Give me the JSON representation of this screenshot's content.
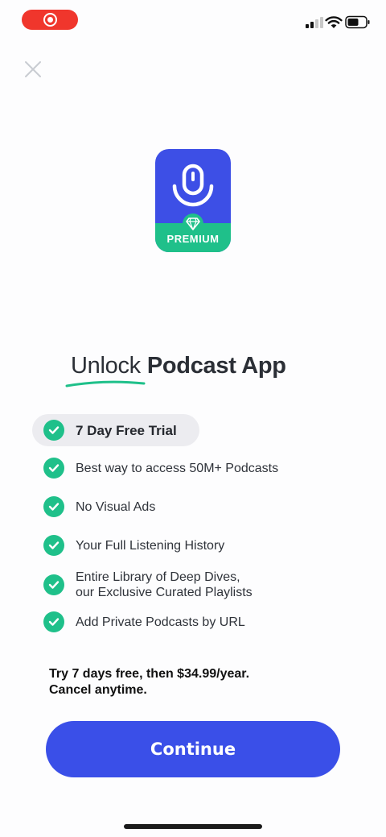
{
  "status_bar": {
    "recording_icon": "record-icon",
    "signal_icon": "cellular-signal-icon",
    "wifi_icon": "wifi-icon",
    "battery_icon": "battery-icon",
    "colors": {
      "recording": "#f0362c"
    }
  },
  "close_icon": "close-icon",
  "app_icon": {
    "icon": "microphone-icon",
    "badge_icon": "diamond-icon",
    "badge_label": "PREMIUM",
    "colors": {
      "background": "#3d4fe6",
      "badge": "#1fc08a"
    }
  },
  "headline": {
    "prefix": "Unlock",
    "app_name": "Podcast App",
    "underline_color": "#1fc08a"
  },
  "features": [
    {
      "label": "7 Day Free Trial",
      "highlighted": true
    },
    {
      "label": "Best way to access 50M+ Podcasts"
    },
    {
      "label": "No Visual Ads"
    },
    {
      "label": "Your Full Listening History"
    },
    {
      "label_line1": "Entire Library of Deep Dives,",
      "label_line2": "our Exclusive Curated Playlists"
    },
    {
      "label": "Add Private Podcasts by URL"
    }
  ],
  "check_icon": "checkmark-circle-icon",
  "pricing": {
    "line1": "Try 7 days free, then $34.99/year.",
    "line2": "Cancel anytime."
  },
  "cta": {
    "label": "Continue",
    "color": "#3a4fe8"
  }
}
